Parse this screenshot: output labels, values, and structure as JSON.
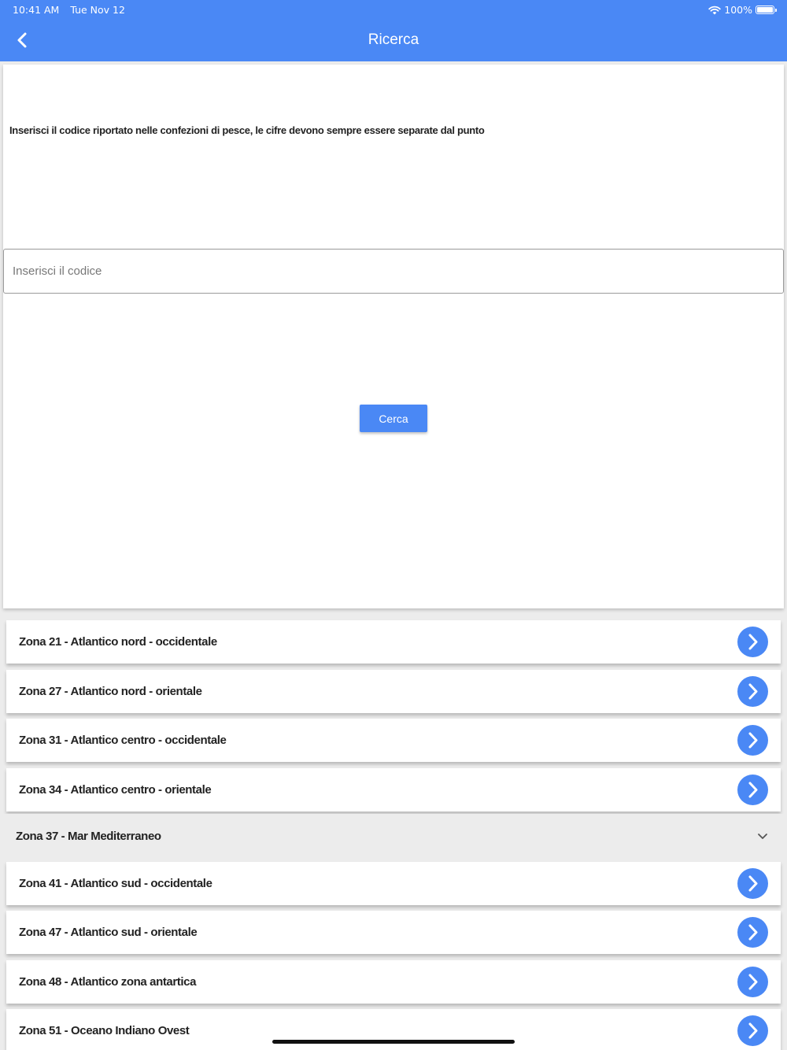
{
  "status_bar": {
    "time": "10:41 AM",
    "date": "Tue Nov 12",
    "battery": "100%"
  },
  "header": {
    "title": "Ricerca",
    "back_icon": "chevron-left-icon"
  },
  "search_card": {
    "instructions": "Inserisci il codice riportato nelle confezioni di pesce, le cifre devono sempre essere separate dal punto",
    "input_placeholder": "Inserisci il codice",
    "input_value": "",
    "button_label": "Cerca"
  },
  "zones": [
    {
      "label": "Zona 21 - Atlantico nord - occidentale",
      "icon": "chevron-right-circle-icon"
    },
    {
      "label": "Zona 27 - Atlantico nord - orientale",
      "icon": "chevron-right-circle-icon"
    },
    {
      "label": "Zona 31 - Atlantico centro - occidentale",
      "icon": "chevron-right-circle-icon"
    },
    {
      "label": "Zona 34 - Atlantico centro - orientale",
      "icon": "chevron-right-circle-icon"
    },
    {
      "label": "Zona 37 - Mar Mediterraneo",
      "icon": "chevron-down-icon",
      "expandable": true
    },
    {
      "label": "Zona 41 - Atlantico sud - occidentale",
      "icon": "chevron-right-circle-icon"
    },
    {
      "label": "Zona 47 - Atlantico sud - orientale",
      "icon": "chevron-right-circle-icon"
    },
    {
      "label": "Zona 48 - Atlantico zona antartica",
      "icon": "chevron-right-circle-icon"
    },
    {
      "label": "Zona 51 - Oceano Indiano Ovest",
      "icon": "chevron-right-circle-icon"
    }
  ],
  "colors": {
    "accent": "#4a88f5",
    "background": "#ececec",
    "text": "#222222"
  }
}
